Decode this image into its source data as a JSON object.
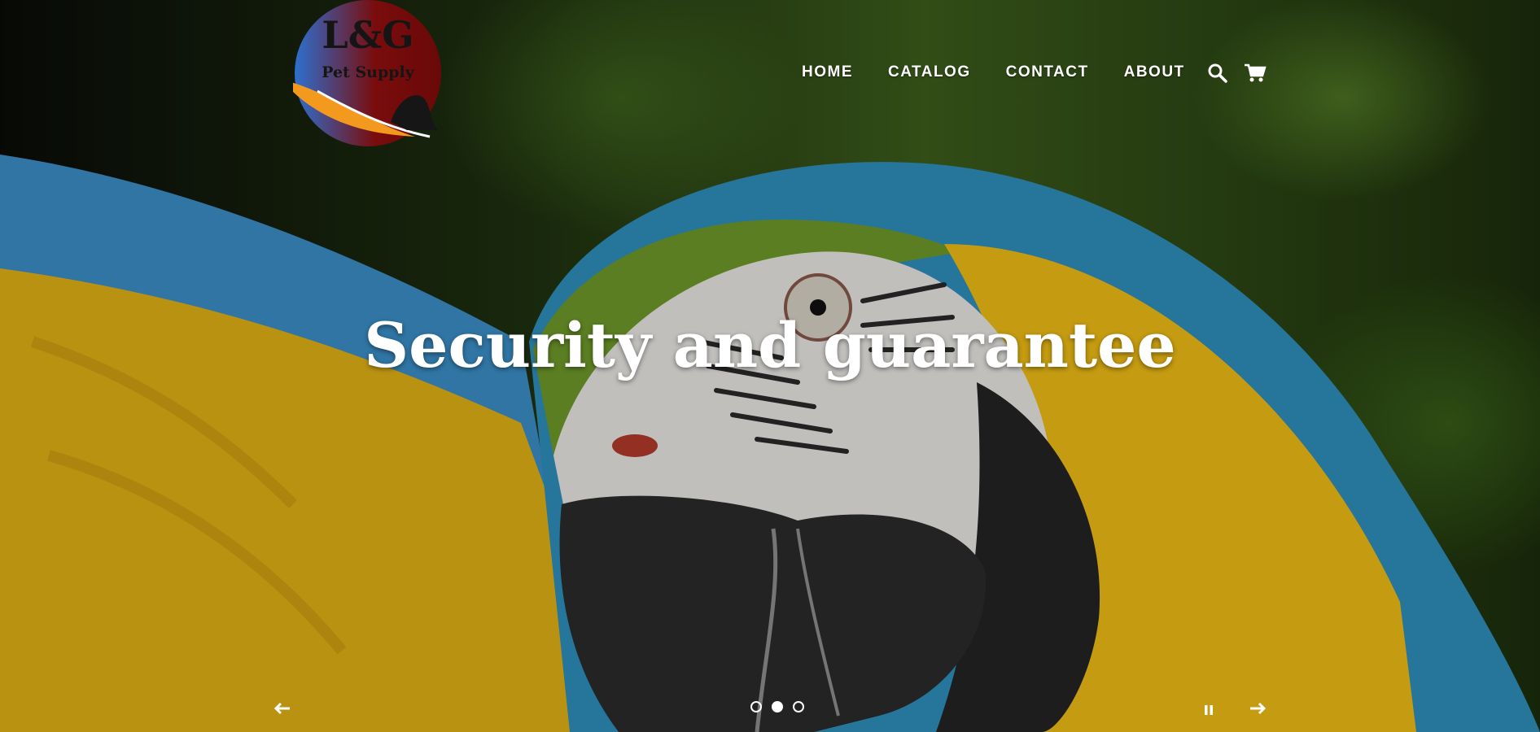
{
  "brand": {
    "logo_line1": "L&G",
    "logo_line2": "Pet Supply",
    "logo_colors": [
      "#2e6fcf",
      "#7a0c0c"
    ],
    "accent": "#f39a1e"
  },
  "nav": {
    "links": [
      "HOME",
      "CATALOG",
      "CONTACT",
      "ABOUT"
    ],
    "icons": [
      "search-icon",
      "cart-icon"
    ]
  },
  "hero": {
    "headline": "Security and guarantee",
    "active_slide": 2,
    "slide_count": 3,
    "controls": [
      "arrow-left-icon",
      "pause-icon",
      "arrow-right-icon"
    ]
  }
}
